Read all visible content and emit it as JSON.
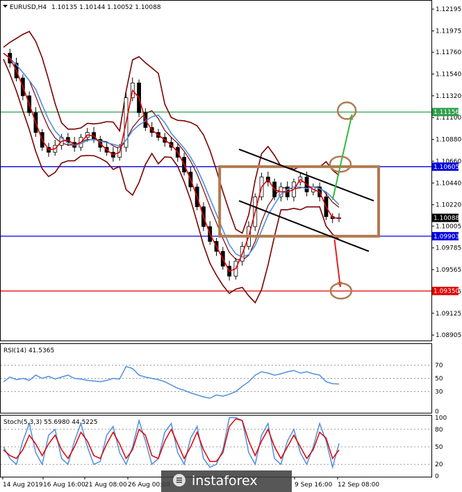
{
  "chart_data": {
    "type": "candlestick",
    "header": {
      "symbol": "EURUSD,H4",
      "ohlc": "1.10135 1.10144 1.10052 1.10088"
    },
    "main_panel": {
      "ylim": [
        1.0885,
        1.1228
      ],
      "y_ticks": [
        "1.12195",
        "1.11975",
        "1.11760",
        "1.11540",
        "1.11320",
        "1.11100",
        "1.10880",
        "1.10660",
        "1.10440",
        "1.10220",
        "1.10005",
        "1.09785",
        "1.09565",
        "1.09345",
        "1.09125",
        "1.08905"
      ],
      "y_tick_values": [
        1.12195,
        1.11975,
        1.1176,
        1.1154,
        1.1132,
        1.111,
        1.1088,
        1.1066,
        1.1044,
        1.1022,
        1.10005,
        1.09785,
        1.09565,
        1.09345,
        1.09125,
        1.08905
      ],
      "levels": [
        {
          "value": 1.11156,
          "label": "1.11156",
          "color": "#2e9e4a"
        },
        {
          "value": 1.10605,
          "label": "1.10605",
          "color": "#0000e0"
        },
        {
          "value": 1.09903,
          "label": "1.09903",
          "color": "#0000e0"
        },
        {
          "value": 1.0935,
          "label": "1.09350",
          "color": "#e00000"
        }
      ],
      "current_price": {
        "value": 1.10088,
        "label": "1.10088"
      },
      "close_path": [
        1.1175,
        1.1165,
        1.115,
        1.1132,
        1.1115,
        1.1095,
        1.108,
        1.1075,
        1.1082,
        1.109,
        1.1085,
        1.108,
        1.109,
        1.1095,
        1.1088,
        1.108,
        1.1075,
        1.107,
        1.108,
        1.113,
        1.1145,
        1.1115,
        1.11,
        1.1095,
        1.109,
        1.1085,
        1.108,
        1.107,
        1.1055,
        1.104,
        1.102,
        1.1,
        1.0985,
        1.0975,
        1.096,
        1.095,
        1.0965,
        1.098,
        1.1,
        1.103,
        1.105,
        1.1045,
        1.103,
        1.104,
        1.103,
        1.1045,
        1.105,
        1.1035,
        1.104,
        1.103,
        1.101,
        1.1008,
        1.1009
      ],
      "ma_fast_color": "#e00000",
      "ma_slow_color": "#4f8fdf",
      "bollinger_color": "#7a0000"
    },
    "rsi_panel": {
      "label": "RSI(14) 41.5365",
      "levels": [
        70,
        50,
        30
      ],
      "tick_labels": [
        "70",
        "50",
        "30",
        "0"
      ],
      "values": [
        45,
        52,
        48,
        50,
        47,
        55,
        50,
        53,
        49,
        52,
        55,
        50,
        49,
        47,
        46,
        45,
        47,
        50,
        49,
        68,
        65,
        55,
        52,
        50,
        48,
        45,
        40,
        35,
        32,
        28,
        25,
        22,
        20,
        25,
        23,
        26,
        30,
        38,
        45,
        55,
        60,
        58,
        55,
        57,
        60,
        62,
        58,
        60,
        57,
        55,
        45,
        42,
        41.5
      ]
    },
    "stoch_panel": {
      "label": "Stoch(5,3,3) 55.6980 44.5225",
      "levels": [
        80,
        50,
        20
      ],
      "tick_labels": [
        "100",
        "80",
        "50",
        "20",
        "0"
      ],
      "k": [
        50,
        30,
        20,
        60,
        90,
        40,
        20,
        70,
        80,
        30,
        20,
        60,
        90,
        50,
        20,
        25,
        70,
        85,
        40,
        20,
        50,
        95,
        60,
        20,
        30,
        75,
        90,
        40,
        20,
        65,
        85,
        30,
        15,
        20,
        45,
        100,
        100,
        95,
        40,
        20,
        70,
        90,
        30,
        20,
        60,
        80,
        40,
        20,
        50,
        90,
        60,
        15,
        55.7
      ],
      "d": [
        45,
        35,
        30,
        45,
        70,
        55,
        35,
        55,
        70,
        45,
        30,
        50,
        75,
        60,
        35,
        30,
        55,
        75,
        55,
        30,
        45,
        80,
        70,
        35,
        30,
        60,
        80,
        55,
        30,
        50,
        75,
        45,
        25,
        25,
        40,
        85,
        98,
        95,
        60,
        35,
        60,
        80,
        50,
        30,
        50,
        70,
        50,
        30,
        45,
        75,
        65,
        30,
        44.5
      ]
    },
    "x_ticks": [
      "14 Aug 2019",
      "16 Aug 16:00",
      "21 Aug 08:00",
      "26 Aug 00:00",
      "9 Sep 16:00",
      "12 Sep 08:00"
    ],
    "annotations": {
      "box_color": "#b07a50",
      "channel_color": "#000000",
      "up_arrow_color": "#2dbb3d",
      "down_arrow_color": "#e02020"
    },
    "watermark": "instaforex"
  }
}
